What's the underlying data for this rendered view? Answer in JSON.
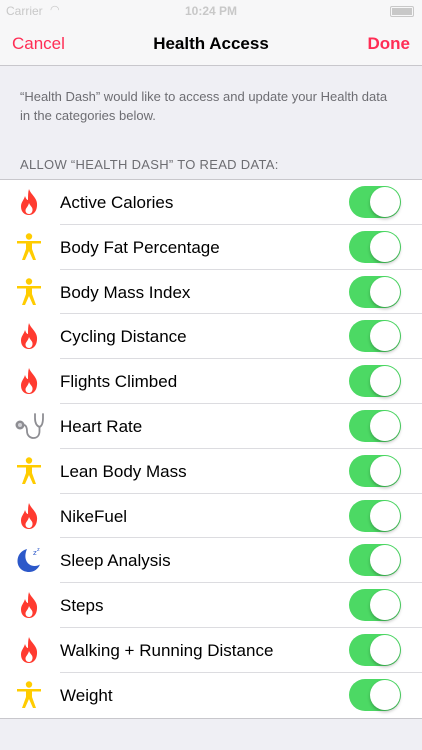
{
  "status_bar": {
    "carrier": "Carrier",
    "time": "10:24 PM"
  },
  "nav": {
    "cancel_label": "Cancel",
    "title": "Health Access",
    "done_label": "Done"
  },
  "intro_text": "“Health Dash” would like to access and update your Health data in the categories below.",
  "section_header": "ALLOW “HEALTH DASH” TO READ DATA:",
  "colors": {
    "accent": "#ff2d55",
    "toggle_on": "#4cd964",
    "flame": "#ff3b30",
    "figure": "#ffcc00",
    "moon": "#2c58c9",
    "stethoscope": "#8e8e93"
  },
  "items": [
    {
      "label": "Active Calories",
      "icon": "flame-icon",
      "enabled": true
    },
    {
      "label": "Body Fat Percentage",
      "icon": "person-icon",
      "enabled": true
    },
    {
      "label": "Body Mass Index",
      "icon": "person-icon",
      "enabled": true
    },
    {
      "label": "Cycling Distance",
      "icon": "flame-icon",
      "enabled": true
    },
    {
      "label": "Flights Climbed",
      "icon": "flame-icon",
      "enabled": true
    },
    {
      "label": "Heart Rate",
      "icon": "stethoscope-icon",
      "enabled": true
    },
    {
      "label": "Lean Body Mass",
      "icon": "person-icon",
      "enabled": true
    },
    {
      "label": "NikeFuel",
      "icon": "flame-icon",
      "enabled": true
    },
    {
      "label": "Sleep Analysis",
      "icon": "moon-icon",
      "enabled": true
    },
    {
      "label": "Steps",
      "icon": "flame-icon",
      "enabled": true
    },
    {
      "label": "Walking + Running Distance",
      "icon": "flame-icon",
      "enabled": true
    },
    {
      "label": "Weight",
      "icon": "person-icon",
      "enabled": true
    }
  ]
}
